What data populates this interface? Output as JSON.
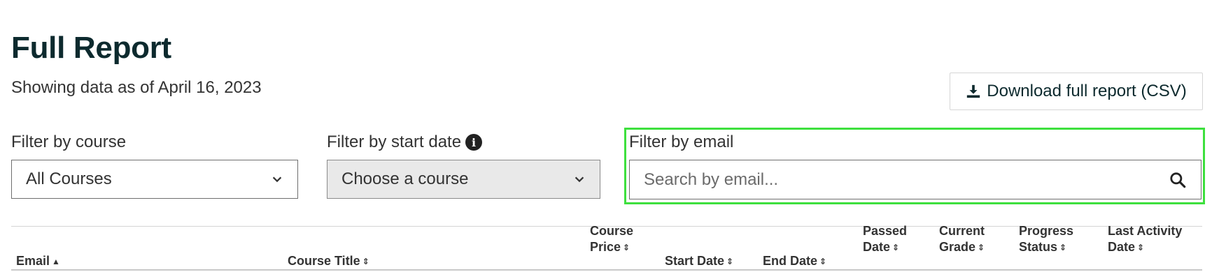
{
  "page": {
    "title": "Full Report",
    "subtitle": "Showing data as of April 16, 2023"
  },
  "download": {
    "label": "Download full report (CSV)"
  },
  "filters": {
    "course": {
      "label": "Filter by course",
      "value": "All Courses"
    },
    "start_date": {
      "label": "Filter by start date",
      "value": "Choose a course",
      "disabled": true
    },
    "email": {
      "label": "Filter by email",
      "placeholder": "Search by email..."
    }
  },
  "table": {
    "columns": [
      {
        "line1": "",
        "line2": "Email",
        "sort": "asc"
      },
      {
        "line1": "",
        "line2": "Course Title",
        "sort": "none"
      },
      {
        "line1": "Course",
        "line2": "Price",
        "sort": "none"
      },
      {
        "line1": "",
        "line2": "Start Date",
        "sort": "none"
      },
      {
        "line1": "",
        "line2": "End Date",
        "sort": "none"
      },
      {
        "line1": "Passed",
        "line2": "Date",
        "sort": "none"
      },
      {
        "line1": "Current",
        "line2": "Grade",
        "sort": "none"
      },
      {
        "line1": "Progress",
        "line2": "Status",
        "sort": "none"
      },
      {
        "line1": "Last Activity",
        "line2": "Date",
        "sort": "none"
      }
    ]
  },
  "colors": {
    "title": "#0d2a2e",
    "highlight": "#3ee03e",
    "disabled_bg": "#e9e9e9"
  },
  "icons": {
    "download": "download-icon",
    "info": "info-icon",
    "chevron": "chevron-down-icon",
    "search": "search-icon",
    "sort_asc": "sort-asc-icon",
    "sort": "sort-icon"
  }
}
